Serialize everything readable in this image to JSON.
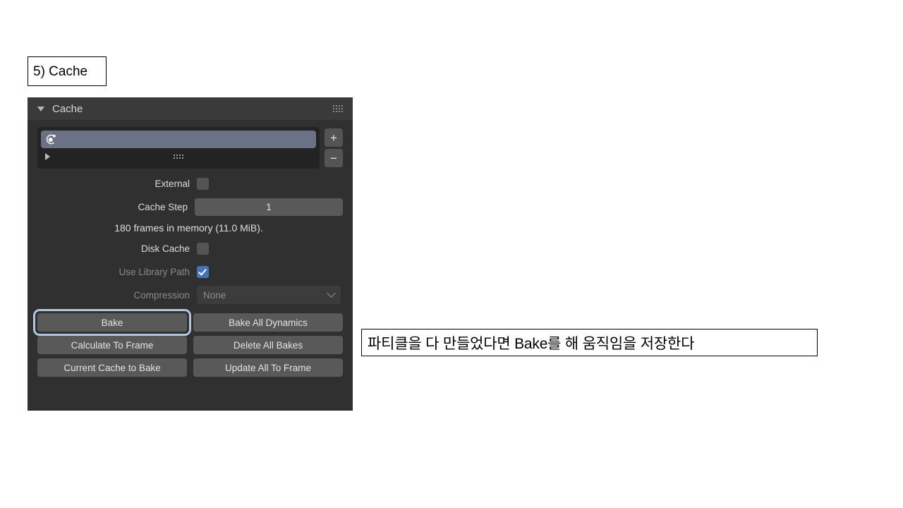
{
  "slide": {
    "title": "5) Cache",
    "caption": "파티클을 다 만들었다면 Bake를 해 움직임을 저장한다"
  },
  "panel": {
    "header_title": "Cache",
    "disclosure_icon": "triangle-down-icon",
    "grip_icon": "grip-dots-icon",
    "list": {
      "item_icon": "physics-particle-icon",
      "item_label": "",
      "expand_icon": "triangle-right-icon",
      "grip_icon": "grip-dots-icon",
      "add_button": "+",
      "remove_button": "−"
    },
    "properties": [
      {
        "label": "External",
        "type": "checkbox",
        "checked": false,
        "disabled": false
      },
      {
        "label": "Cache Step",
        "type": "number",
        "value": "1",
        "disabled": false
      },
      {
        "label": "Disk Cache",
        "type": "checkbox",
        "checked": false,
        "disabled": false
      },
      {
        "label": "Use Library Path",
        "type": "checkbox",
        "checked": true,
        "disabled": true
      },
      {
        "label": "Compression",
        "type": "dropdown",
        "value": "None",
        "disabled": true
      }
    ],
    "labels": {
      "external": "External",
      "cache_step": "Cache Step",
      "cache_step_value": "1",
      "disk_cache": "Disk Cache",
      "use_library_path": "Use Library Path",
      "compression": "Compression",
      "compression_value": "None"
    },
    "info_text": "180 frames in memory (11.0 MiB).",
    "buttons": {
      "bake": "Bake",
      "bake_all_dynamics": "Bake All Dynamics",
      "calculate_to_frame": "Calculate To Frame",
      "delete_all_bakes": "Delete All Bakes",
      "current_cache_to_bake": "Current Cache to Bake",
      "update_all_to_frame": "Update All To Frame"
    },
    "highlight": {
      "target": "bake",
      "color": "#b3c6e0"
    }
  },
  "colors": {
    "panel_bg": "#303030",
    "header_bg": "#3a3a3a",
    "button_bg": "#595959",
    "list_bg": "#232323",
    "selected_row": "#6b7285",
    "checkbox_on": "#4772b3",
    "highlight_ring": "#b3c6e0"
  }
}
